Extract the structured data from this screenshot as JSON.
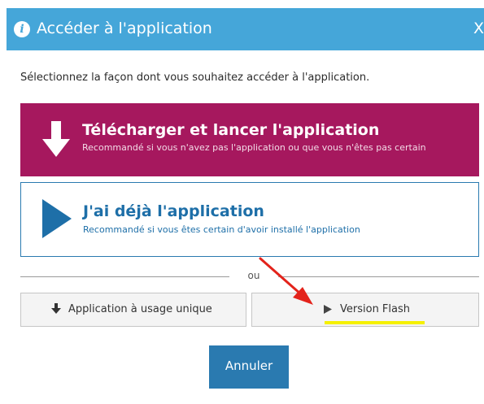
{
  "dialog": {
    "title": "Accéder à l'application",
    "close_label": "X",
    "instruction": "Sélectionnez la façon dont vous souhaitez accéder à l'application."
  },
  "options": {
    "download": {
      "title": "Télécharger et lancer l'application",
      "subtitle": "Recommandé si vous n'avez pas l'application ou que vous n'êtes pas certain"
    },
    "have": {
      "title": "J'ai déjà l'application",
      "subtitle": "Recommandé si vous êtes certain d'avoir installé l'application"
    }
  },
  "separator_text": "ou",
  "buttons": {
    "single_use": "Application à usage unique",
    "flash": "Version Flash",
    "cancel": "Annuler"
  },
  "icons": {
    "info": "info-icon",
    "download": "download-arrow-icon",
    "play": "play-icon",
    "close": "close-icon"
  },
  "colors": {
    "title_bar": "#45a6d9",
    "download_option": "#a6185e",
    "accent_blue": "#2a7ab0",
    "annotation_arrow": "#e3231b",
    "highlight": "#f5f000"
  }
}
